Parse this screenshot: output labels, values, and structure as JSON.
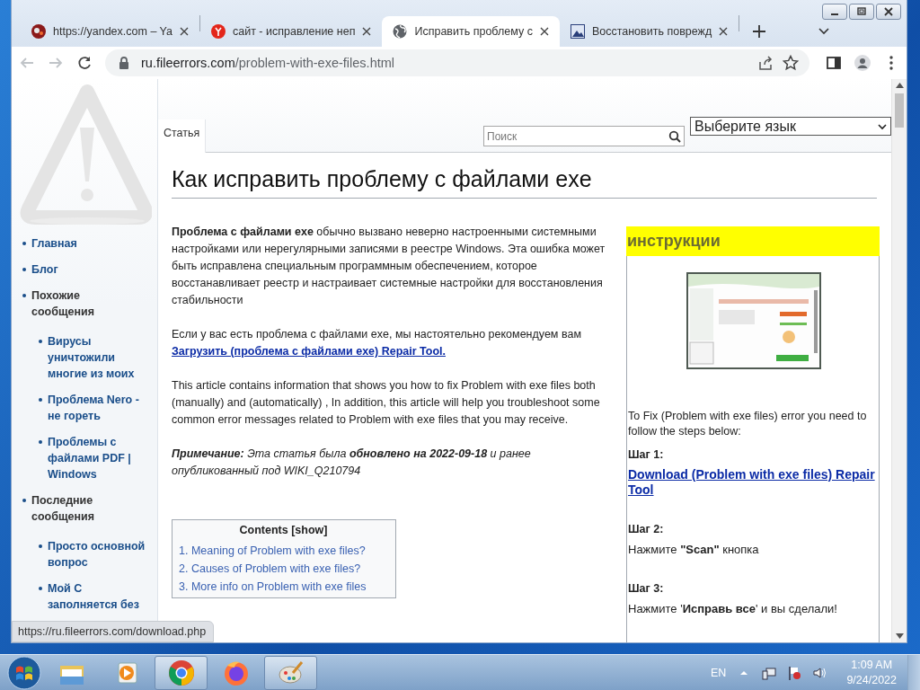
{
  "browser": {
    "tabs": [
      {
        "title": "https://yandex.com – Ya",
        "selected": false
      },
      {
        "title": "сайт - исправление неп",
        "selected": false
      },
      {
        "title": "Исправить проблему с",
        "selected": true
      },
      {
        "title": "Восстановить поврежд",
        "selected": false
      }
    ],
    "address": {
      "domain": "ru.fileerrors.com",
      "path": "/problem-with-exe-files.html"
    },
    "back_disabled": true,
    "forward_disabled": true
  },
  "page": {
    "sidebar": [
      {
        "label": "Главная",
        "kind": "link"
      },
      {
        "label": "Блог",
        "kind": "link"
      },
      {
        "label": "Похожие сообщения",
        "kind": "heading",
        "children": [
          {
            "label": "Вирусы уничтожили многие из моих",
            "kind": "link"
          },
          {
            "label": "Проблема Nero - не гореть",
            "kind": "link"
          },
          {
            "label": "Проблемы с файлами PDF | Windows",
            "kind": "link"
          }
        ]
      },
      {
        "label": "Последние сообщения",
        "kind": "heading",
        "children": [
          {
            "label": "Просто основной вопрос",
            "kind": "link"
          },
          {
            "label": "Мой С заполняется без",
            "kind": "link"
          }
        ]
      }
    ],
    "article_tab": "Статья",
    "search": {
      "placeholder": "Поиск"
    },
    "language_select": "Выберите язык",
    "title": "Как исправить проблему с файлами exe",
    "paragraphs": [
      {
        "kind": "text",
        "text": "**Проблема с файлами exe** обычно вызвано неверно настроенными системными настройками или нерегулярными записями в реестре Windows. Эта ошибка может быть исправлена специальным программным обеспечением, которое восстанавливает реестр и настраивает системные настройки для восстановления стабильности"
      },
      {
        "kind": "text",
        "text": "Если у вас есть проблема с файлами exe, мы настоятельно рекомендуем вам",
        "link": "Загрузить (проблема с файлами exe) Repair Tool."
      },
      {
        "kind": "text",
        "text": "This article contains information that shows you how to fix Problem with exe files both (manually) and (automatically) , In addition, this article will help you troubleshoot some common error messages related to Problem with exe files that you may receive."
      },
      {
        "kind": "note",
        "text": "**Примечание:** Эта статья была **обновлено на 2022-09-18** и ранее опубликованный под WIKI_Q210794"
      }
    ],
    "contents": {
      "title": "Contents [show]",
      "items": [
        "1. Meaning of Problem with exe files?",
        "2. Causes of Problem with exe files?",
        "3. More info on Problem with exe files"
      ]
    },
    "instructions": {
      "title": "инструкции",
      "intro": "To Fix (Problem with exe files) error you need to follow the steps below:",
      "steps": [
        {
          "label": "Шаг 1:",
          "kind": "link",
          "text": "Download (Problem with exe files) Repair Tool"
        },
        {
          "label": "Шаг 2:",
          "kind": "text",
          "text": "Нажмите **\"Scan\"** кнопка"
        },
        {
          "label": "Шаг 3:",
          "kind": "text",
          "text": "Нажмите '**Исправь все**' и вы сделали!"
        }
      ]
    }
  },
  "status_bubble": "https://ru.fileerrors.com/download.php",
  "taskbar": {
    "apps": [
      {
        "kind": "folder",
        "running": false
      },
      {
        "kind": "player",
        "running": false
      },
      {
        "kind": "chrome",
        "running": true
      },
      {
        "kind": "firefox",
        "running": false
      },
      {
        "kind": "paint",
        "running": true
      }
    ],
    "language": "EN",
    "time": "1:09 AM",
    "date": "9/24/2022"
  }
}
